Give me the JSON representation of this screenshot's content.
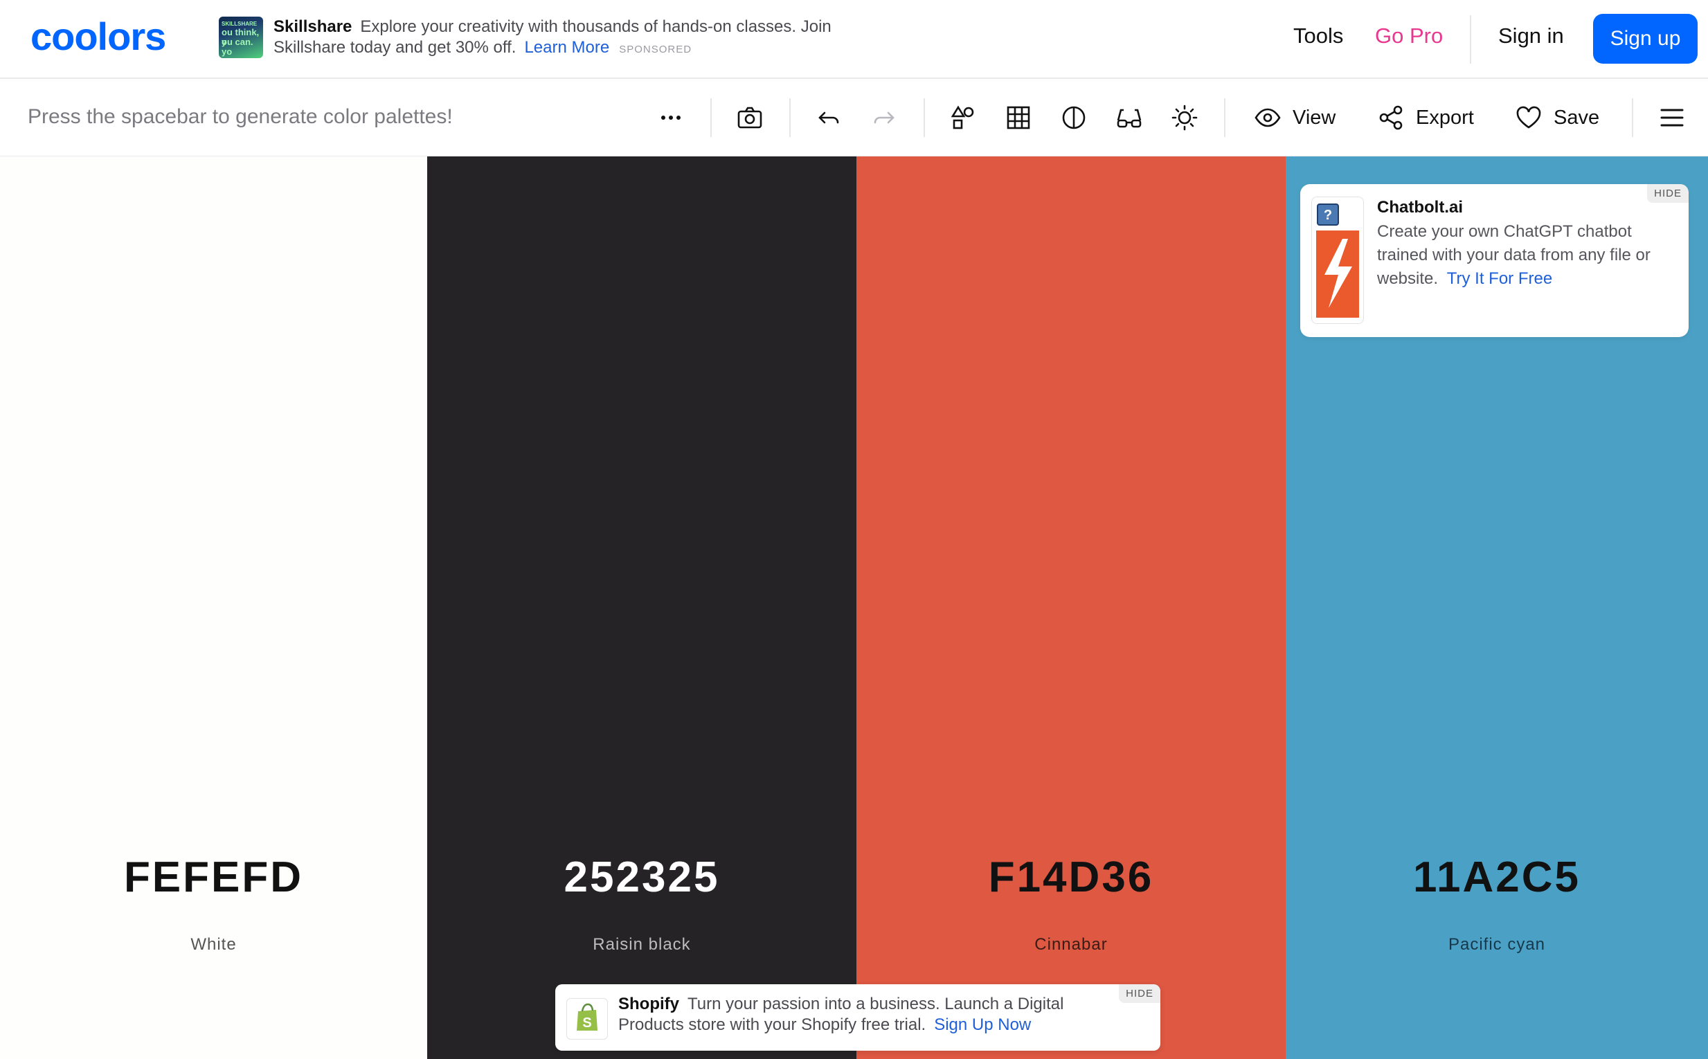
{
  "nav": {
    "logo": "coolors",
    "ad": {
      "brand": "Skillshare",
      "text": "Explore your creativity with thousands of hands-on classes. Join Skillshare today and get 30% off.",
      "link": "Learn More",
      "sponsored": "SPONSORED",
      "thumb_lines": [
        "SKILLSHARE",
        "ou think, y",
        "ou can. yo"
      ]
    },
    "tools": "Tools",
    "go_pro": "Go Pro",
    "sign_in": "Sign in",
    "sign_up": "Sign up"
  },
  "toolbar": {
    "hint": "Press the spacebar to generate color palettes!",
    "icons": [
      "more-icon",
      "camera-icon",
      "undo-icon",
      "redo-icon",
      "shapes-icon",
      "grid-icon",
      "contrast-icon",
      "glasses-icon",
      "sun-icon",
      "menu-icon"
    ],
    "view": "View",
    "export": "Export",
    "save": "Save"
  },
  "palette": [
    {
      "hex": "FEFEFD",
      "name": "White",
      "color": "#FEFEFD",
      "text_color": "#111111",
      "name_color": "#555555"
    },
    {
      "hex": "252325",
      "name": "Raisin black",
      "color": "#252325",
      "text_color": "#FFFFFF",
      "name_color": "#BDBDBD"
    },
    {
      "hex": "F14D36",
      "name": "Cinnabar",
      "color": "#DE5842",
      "text_color": "#111111",
      "name_color": "#3A1C16"
    },
    {
      "hex": "11A2C5",
      "name": "Pacific cyan",
      "color": "#4BA1C5",
      "text_color": "#111111",
      "name_color": "#17384A"
    }
  ],
  "ad_card": {
    "title": "Chatbolt.ai",
    "body": "Create your own ChatGPT chatbot trained with your data from any file or website.",
    "link": "Try It For Free",
    "hide": "HIDE"
  },
  "ad_bottom": {
    "brand": "Shopify",
    "text": "Turn your passion into a business. Launch a Digital Products store with your Shopify free trial.",
    "link": "Sign Up Now",
    "hide": "HIDE"
  },
  "colors": {
    "accent": "#0066ff",
    "pro": "#e8388f",
    "link": "#1f5fd8"
  }
}
